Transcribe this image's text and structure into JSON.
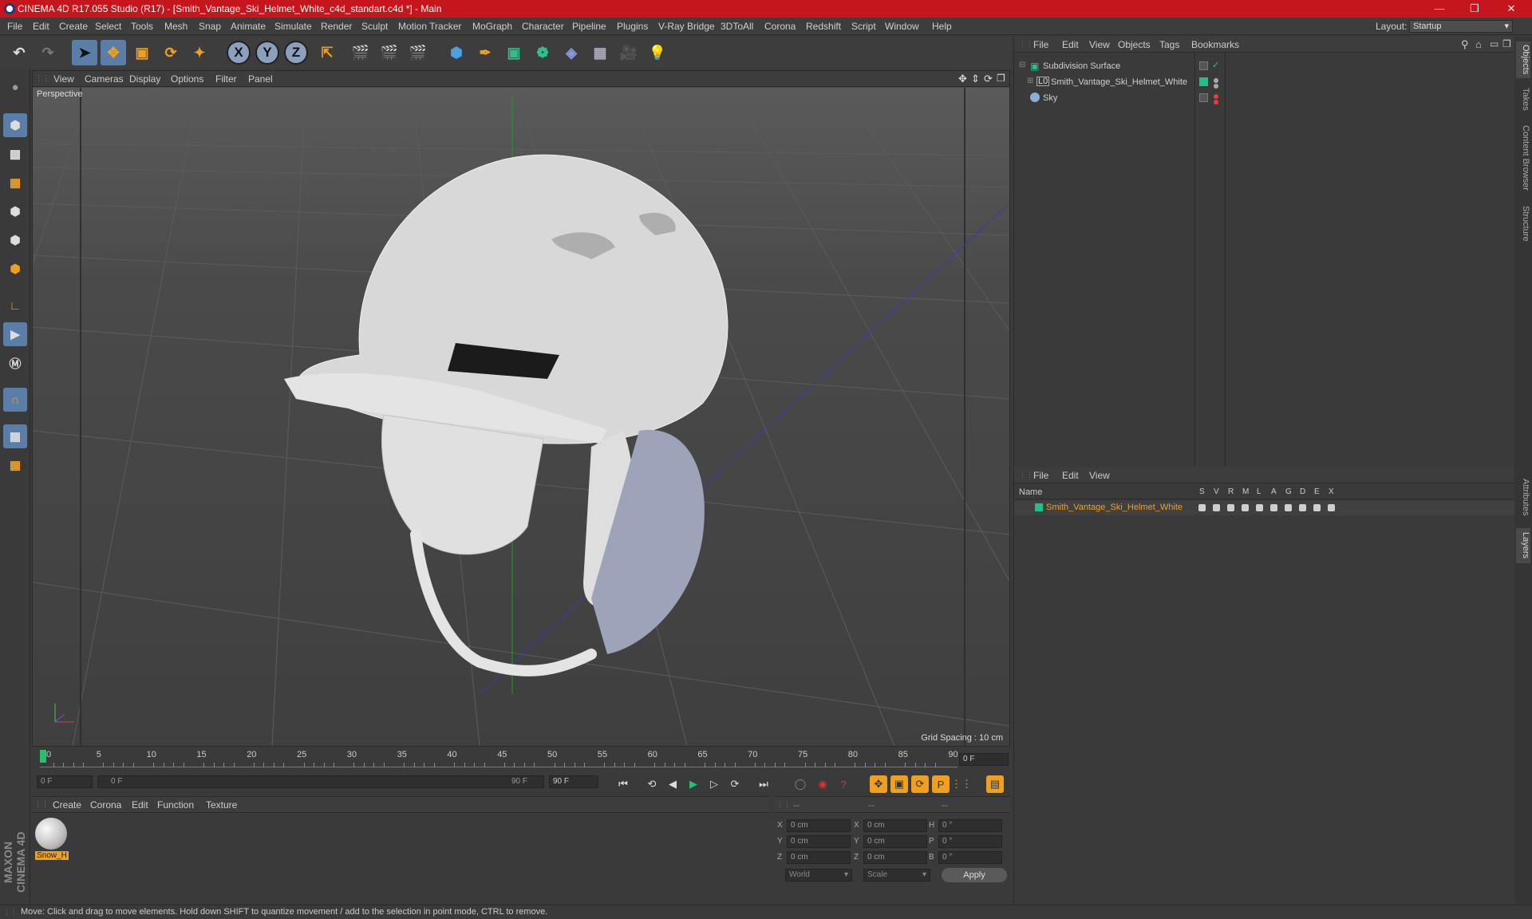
{
  "title": "CINEMA 4D R17.055 Studio (R17) - [Smith_Vantage_Ski_Helmet_White_c4d_standart.c4d *] - Main",
  "menu": [
    "File",
    "Edit",
    "Create",
    "Select",
    "Tools",
    "Mesh",
    "Snap",
    "Animate",
    "Simulate",
    "Render",
    "Sculpt",
    "Motion Tracker",
    "MoGraph",
    "Character",
    "Pipeline",
    "Plugins",
    "V-Ray Bridge",
    "3DToAll",
    "Corona",
    "Redshift",
    "Script",
    "Window",
    "Help"
  ],
  "layout": {
    "label": "Layout:",
    "value": "Startup"
  },
  "viewport": {
    "menu": [
      "View",
      "Cameras",
      "Display",
      "Options",
      "Filter",
      "Panel"
    ],
    "label": "Perspective",
    "grid_spacing": "Grid Spacing : 10 cm"
  },
  "timeline": {
    "ticks": [
      "0",
      "5",
      "10",
      "15",
      "20",
      "25",
      "30",
      "35",
      "40",
      "45",
      "50",
      "55",
      "60",
      "65",
      "70",
      "75",
      "80",
      "85",
      "90"
    ],
    "current": "0 F",
    "start": "0 F",
    "range_start": "0 F",
    "range_end": "90 F",
    "end": "90 F"
  },
  "material_panel": {
    "menu": [
      "Create",
      "Corona",
      "Edit",
      "Function",
      "Texture"
    ],
    "material_name": "Snow_H"
  },
  "attr_panel": {
    "headers": [
      "--",
      "--",
      "--"
    ],
    "rows": [
      {
        "a": "X",
        "av": "0 cm",
        "b": "X",
        "bv": "0 cm",
        "c": "H",
        "cv": "0 °"
      },
      {
        "a": "Y",
        "av": "0 cm",
        "b": "Y",
        "bv": "0 cm",
        "c": "P",
        "cv": "0 °"
      },
      {
        "a": "Z",
        "av": "0 cm",
        "b": "Z",
        "bv": "0 cm",
        "c": "B",
        "cv": "0 °"
      }
    ],
    "coord": "World",
    "mode": "Scale",
    "apply": "Apply"
  },
  "object_panel": {
    "menu": [
      "File",
      "Edit",
      "View",
      "Objects",
      "Tags",
      "Bookmarks"
    ],
    "objects": [
      {
        "name": "Subdivision Surface"
      },
      {
        "name": "Smith_Vantage_Ski_Helmet_White"
      },
      {
        "name": "Sky"
      }
    ]
  },
  "layer_panel": {
    "menu": [
      "File",
      "Edit",
      "View"
    ],
    "name_header": "Name",
    "flags": [
      "S",
      "V",
      "R",
      "M",
      "L",
      "A",
      "G",
      "D",
      "E",
      "X"
    ],
    "layer": "Smith_Vantage_Ski_Helmet_White"
  },
  "side_tabs": [
    "Objects",
    "Takes",
    "Content Browser",
    "Structure",
    "Attributes",
    "Layers"
  ],
  "brand": "MAXON CINEMA 4D",
  "status": "Move: Click and drag to move elements. Hold down SHIFT to quantize movement / add to the selection in point mode, CTRL to remove.",
  "colors": {
    "titlebar": "#c4161c",
    "accent": "#5a7ea8",
    "layer_orange": "#f0a020",
    "layer_green": "#1fc08a"
  }
}
